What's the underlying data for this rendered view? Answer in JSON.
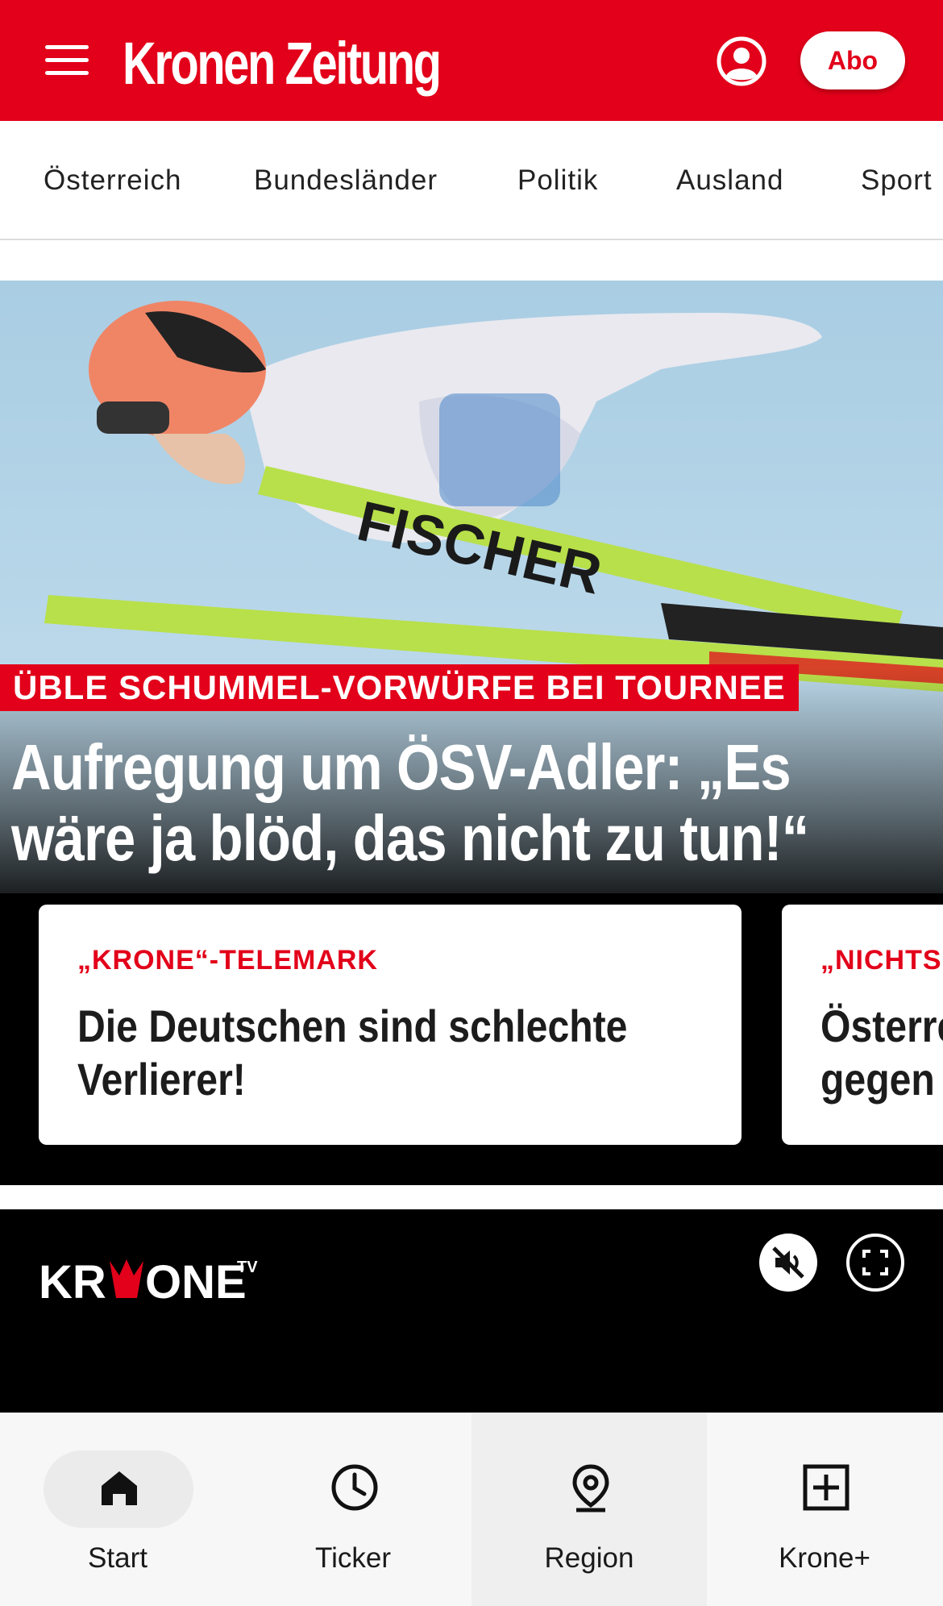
{
  "header": {
    "logo_text": "Kronen Zeitung",
    "abo_label": "Abo",
    "brand_color": "#e2001a",
    "icons": [
      "menu-icon",
      "user-account-icon"
    ]
  },
  "nav": {
    "items": [
      {
        "label": "Österreich"
      },
      {
        "label": "Bundesländer"
      },
      {
        "label": "Politik"
      },
      {
        "label": "Ausland"
      },
      {
        "label": "Sport"
      }
    ]
  },
  "hero": {
    "kicker": "ÜBLE SCHUMMEL-VORWÜRFE BEI TOURNEE",
    "headline_line1": "Aufregung um ÖSV-Adler: „Es",
    "headline_line2": "wäre ja blöd, das nicht zu tun!“"
  },
  "cards": [
    {
      "kicker": "„KRONE“-TELEMARK",
      "title_line1": "Die Deutschen sind schlechte",
      "title_line2": "Verlierer!"
    },
    {
      "kicker": "„NICHTS",
      "title_line1": "Österre",
      "title_line2": "gegen"
    }
  ],
  "tv": {
    "logo_text": "KR",
    "logo_text_2": "ONE",
    "logo_sup": "TV",
    "icons": [
      "mute-icon",
      "fullscreen-icon"
    ]
  },
  "bottom_nav": {
    "items": [
      {
        "label": "Start",
        "icon": "home-icon"
      },
      {
        "label": "Ticker",
        "icon": "clock-icon"
      },
      {
        "label": "Region",
        "icon": "location-pin-icon"
      },
      {
        "label": "Krone+",
        "icon": "plus-box-icon"
      }
    ]
  }
}
